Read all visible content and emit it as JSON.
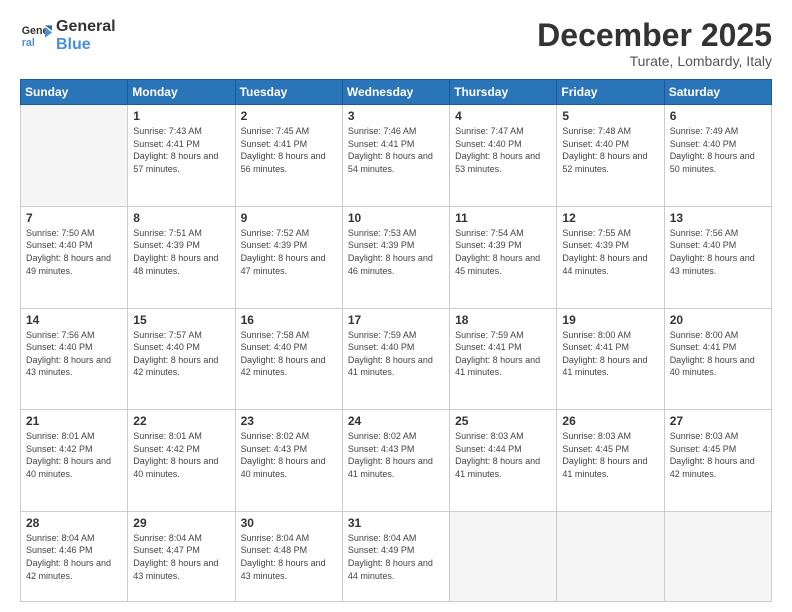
{
  "header": {
    "logo_line1": "General",
    "logo_line2": "Blue",
    "month": "December 2025",
    "location": "Turate, Lombardy, Italy"
  },
  "weekdays": [
    "Sunday",
    "Monday",
    "Tuesday",
    "Wednesday",
    "Thursday",
    "Friday",
    "Saturday"
  ],
  "weeks": [
    [
      {
        "day": "",
        "sunrise": "",
        "sunset": "",
        "daylight": ""
      },
      {
        "day": "1",
        "sunrise": "Sunrise: 7:43 AM",
        "sunset": "Sunset: 4:41 PM",
        "daylight": "Daylight: 8 hours and 57 minutes."
      },
      {
        "day": "2",
        "sunrise": "Sunrise: 7:45 AM",
        "sunset": "Sunset: 4:41 PM",
        "daylight": "Daylight: 8 hours and 56 minutes."
      },
      {
        "day": "3",
        "sunrise": "Sunrise: 7:46 AM",
        "sunset": "Sunset: 4:41 PM",
        "daylight": "Daylight: 8 hours and 54 minutes."
      },
      {
        "day": "4",
        "sunrise": "Sunrise: 7:47 AM",
        "sunset": "Sunset: 4:40 PM",
        "daylight": "Daylight: 8 hours and 53 minutes."
      },
      {
        "day": "5",
        "sunrise": "Sunrise: 7:48 AM",
        "sunset": "Sunset: 4:40 PM",
        "daylight": "Daylight: 8 hours and 52 minutes."
      },
      {
        "day": "6",
        "sunrise": "Sunrise: 7:49 AM",
        "sunset": "Sunset: 4:40 PM",
        "daylight": "Daylight: 8 hours and 50 minutes."
      }
    ],
    [
      {
        "day": "7",
        "sunrise": "Sunrise: 7:50 AM",
        "sunset": "Sunset: 4:40 PM",
        "daylight": "Daylight: 8 hours and 49 minutes."
      },
      {
        "day": "8",
        "sunrise": "Sunrise: 7:51 AM",
        "sunset": "Sunset: 4:39 PM",
        "daylight": "Daylight: 8 hours and 48 minutes."
      },
      {
        "day": "9",
        "sunrise": "Sunrise: 7:52 AM",
        "sunset": "Sunset: 4:39 PM",
        "daylight": "Daylight: 8 hours and 47 minutes."
      },
      {
        "day": "10",
        "sunrise": "Sunrise: 7:53 AM",
        "sunset": "Sunset: 4:39 PM",
        "daylight": "Daylight: 8 hours and 46 minutes."
      },
      {
        "day": "11",
        "sunrise": "Sunrise: 7:54 AM",
        "sunset": "Sunset: 4:39 PM",
        "daylight": "Daylight: 8 hours and 45 minutes."
      },
      {
        "day": "12",
        "sunrise": "Sunrise: 7:55 AM",
        "sunset": "Sunset: 4:39 PM",
        "daylight": "Daylight: 8 hours and 44 minutes."
      },
      {
        "day": "13",
        "sunrise": "Sunrise: 7:56 AM",
        "sunset": "Sunset: 4:40 PM",
        "daylight": "Daylight: 8 hours and 43 minutes."
      }
    ],
    [
      {
        "day": "14",
        "sunrise": "Sunrise: 7:56 AM",
        "sunset": "Sunset: 4:40 PM",
        "daylight": "Daylight: 8 hours and 43 minutes."
      },
      {
        "day": "15",
        "sunrise": "Sunrise: 7:57 AM",
        "sunset": "Sunset: 4:40 PM",
        "daylight": "Daylight: 8 hours and 42 minutes."
      },
      {
        "day": "16",
        "sunrise": "Sunrise: 7:58 AM",
        "sunset": "Sunset: 4:40 PM",
        "daylight": "Daylight: 8 hours and 42 minutes."
      },
      {
        "day": "17",
        "sunrise": "Sunrise: 7:59 AM",
        "sunset": "Sunset: 4:40 PM",
        "daylight": "Daylight: 8 hours and 41 minutes."
      },
      {
        "day": "18",
        "sunrise": "Sunrise: 7:59 AM",
        "sunset": "Sunset: 4:41 PM",
        "daylight": "Daylight: 8 hours and 41 minutes."
      },
      {
        "day": "19",
        "sunrise": "Sunrise: 8:00 AM",
        "sunset": "Sunset: 4:41 PM",
        "daylight": "Daylight: 8 hours and 41 minutes."
      },
      {
        "day": "20",
        "sunrise": "Sunrise: 8:00 AM",
        "sunset": "Sunset: 4:41 PM",
        "daylight": "Daylight: 8 hours and 40 minutes."
      }
    ],
    [
      {
        "day": "21",
        "sunrise": "Sunrise: 8:01 AM",
        "sunset": "Sunset: 4:42 PM",
        "daylight": "Daylight: 8 hours and 40 minutes."
      },
      {
        "day": "22",
        "sunrise": "Sunrise: 8:01 AM",
        "sunset": "Sunset: 4:42 PM",
        "daylight": "Daylight: 8 hours and 40 minutes."
      },
      {
        "day": "23",
        "sunrise": "Sunrise: 8:02 AM",
        "sunset": "Sunset: 4:43 PM",
        "daylight": "Daylight: 8 hours and 40 minutes."
      },
      {
        "day": "24",
        "sunrise": "Sunrise: 8:02 AM",
        "sunset": "Sunset: 4:43 PM",
        "daylight": "Daylight: 8 hours and 41 minutes."
      },
      {
        "day": "25",
        "sunrise": "Sunrise: 8:03 AM",
        "sunset": "Sunset: 4:44 PM",
        "daylight": "Daylight: 8 hours and 41 minutes."
      },
      {
        "day": "26",
        "sunrise": "Sunrise: 8:03 AM",
        "sunset": "Sunset: 4:45 PM",
        "daylight": "Daylight: 8 hours and 41 minutes."
      },
      {
        "day": "27",
        "sunrise": "Sunrise: 8:03 AM",
        "sunset": "Sunset: 4:45 PM",
        "daylight": "Daylight: 8 hours and 42 minutes."
      }
    ],
    [
      {
        "day": "28",
        "sunrise": "Sunrise: 8:04 AM",
        "sunset": "Sunset: 4:46 PM",
        "daylight": "Daylight: 8 hours and 42 minutes."
      },
      {
        "day": "29",
        "sunrise": "Sunrise: 8:04 AM",
        "sunset": "Sunset: 4:47 PM",
        "daylight": "Daylight: 8 hours and 43 minutes."
      },
      {
        "day": "30",
        "sunrise": "Sunrise: 8:04 AM",
        "sunset": "Sunset: 4:48 PM",
        "daylight": "Daylight: 8 hours and 43 minutes."
      },
      {
        "day": "31",
        "sunrise": "Sunrise: 8:04 AM",
        "sunset": "Sunset: 4:49 PM",
        "daylight": "Daylight: 8 hours and 44 minutes."
      },
      {
        "day": "",
        "sunrise": "",
        "sunset": "",
        "daylight": ""
      },
      {
        "day": "",
        "sunrise": "",
        "sunset": "",
        "daylight": ""
      },
      {
        "day": "",
        "sunrise": "",
        "sunset": "",
        "daylight": ""
      }
    ]
  ]
}
